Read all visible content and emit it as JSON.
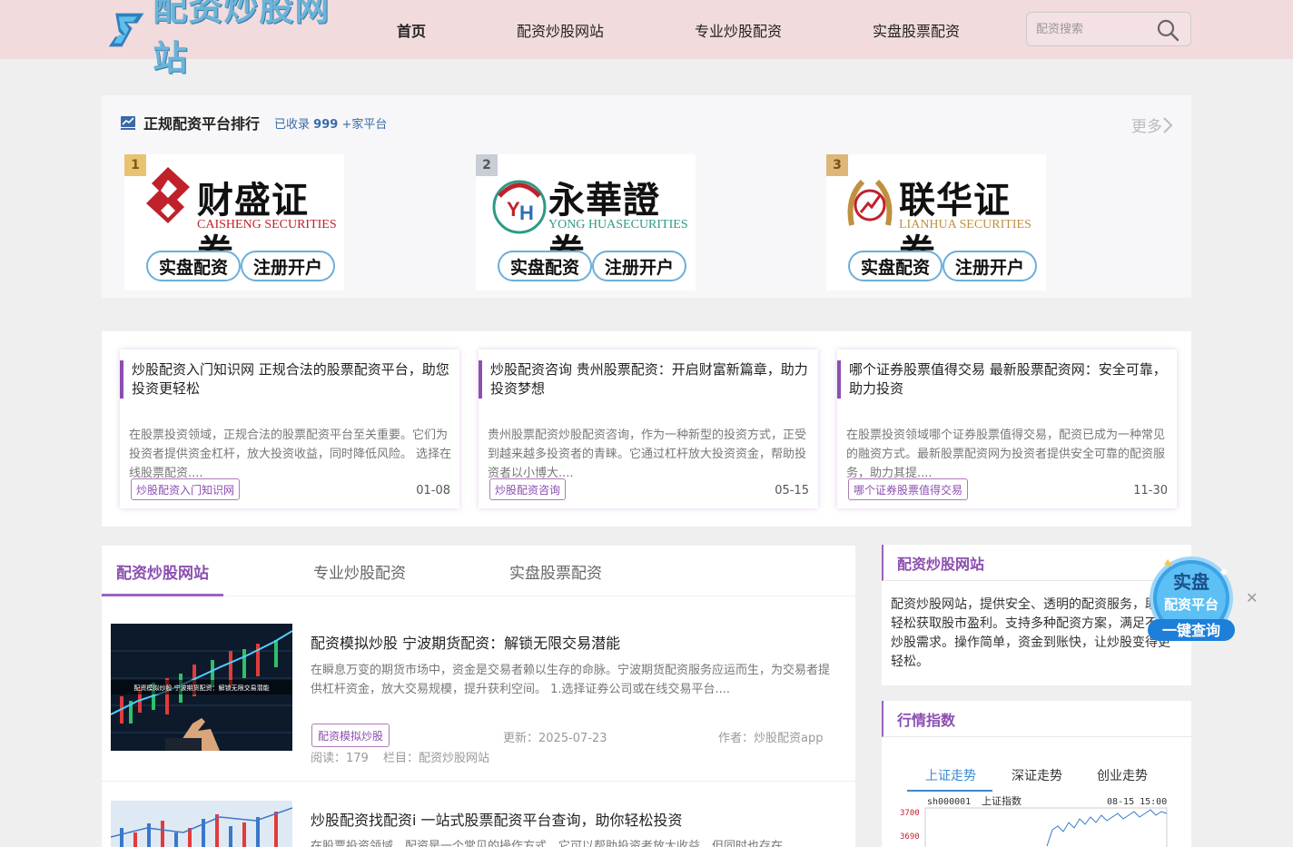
{
  "header": {
    "logo_text": "配资炒股网站",
    "nav": [
      "首页",
      "配资炒股网站",
      "专业炒股配资",
      "实盘股票配资"
    ],
    "search_placeholder": "配资搜索"
  },
  "ranking": {
    "title": "正规配资平台排行",
    "count_prefix": "已收录",
    "count_value": "999",
    "count_suffix": "+家平台",
    "more": "更多",
    "cards": [
      {
        "rank": "1",
        "name_cn": "财盛证券",
        "name_en": "CAISHENG SECURITIES",
        "btn1": "实盘配资",
        "btn2": "注册开户",
        "en_color": "#c0212b"
      },
      {
        "rank": "2",
        "name_cn": "永華證券",
        "name_en": "YONG HUASECURITIES",
        "btn1": "实盘配资",
        "btn2": "注册开户",
        "en_color": "#2c9a86"
      },
      {
        "rank": "3",
        "name_cn": "联华证券",
        "name_en": "LIANHUA SECURITIES",
        "btn1": "实盘配资",
        "btn2": "注册开户",
        "en_color": "#c09040"
      }
    ]
  },
  "articles": [
    {
      "title": "炒股配资入门知识网 正规合法的股票配资平台，助您投资更轻松",
      "desc": "在股票投资领域，正规合法的股票配资平台至关重要。它们为投资者提供资金杠杆，放大投资收益，同时降低风险。 选择在线股票配资....",
      "tag": "炒股配资入门知识网",
      "date": "01-08"
    },
    {
      "title": "炒股配资咨询 贵州股票配资：开启财富新篇章，助力投资梦想",
      "desc": "贵州股票配资炒股配资咨询，作为一种新型的投资方式，正受到越来越多投资者的青睐。它通过杠杆放大投资资金，帮助投资者以小博大....",
      "tag": "炒股配资咨询",
      "date": "05-15"
    },
    {
      "title": "哪个证券股票值得交易 最新股票配资网：安全可靠，助力投资",
      "desc": "在股票投资领域哪个证券股票值得交易，配资已成为一种常见的融资方式。最新股票配资网为投资者提供安全可靠的配资服务，助力其提....",
      "tag": "哪个证券股票值得交易",
      "date": "11-30"
    }
  ],
  "main": {
    "tabs": [
      "配资炒股网站",
      "专业炒股配资",
      "实盘股票配资"
    ],
    "posts": [
      {
        "title": "配资模拟炒股 宁波期货配资：解锁无限交易潜能",
        "desc": "在瞬息万变的期货市场中，资金是交易者赖以生存的命脉。宁波期货配资服务应运而生，为交易者提供杠杆资金，放大交易规模，提升获利空间。 1.选择证券公司或在线交易平台....",
        "tag": "配资模拟炒股",
        "updated": "更新：2025-07-23",
        "author": "作者：炒股配资app",
        "reads": "阅读：179",
        "column": "栏目：配资炒股网站",
        "thumb_caption": "配资模拟炒股 宁波期货配资：解锁无限交易潜能"
      },
      {
        "title": "炒股配资找配资i 一站式股票配资平台查询，助你轻松投资",
        "desc": "在股票投资领域，配资是一个常见的操作方式，它可以帮助投资者放大收益，但同时也存在",
        "tag": "",
        "updated": "",
        "author": "",
        "reads": "",
        "column": "",
        "thumb_caption": ""
      }
    ]
  },
  "sidebar": {
    "about_title": "配资炒股网站",
    "about_text": "配资炒股网站，提供安全、透明的配资服务，助您轻松获取股市盈利。支持多种配资方案，满足不同炒股需求。操作简单，资金到账快，让炒股变得更轻松。",
    "index_title": "行情指数",
    "index_tabs": [
      "上证走势",
      "深证走势",
      "创业走势"
    ],
    "chart": {
      "code": "sh000001",
      "name": "上证指数",
      "time": "08-15 15:00",
      "y_top": "3700",
      "y_second": "3690"
    }
  },
  "float_widget": {
    "line1": "实盘",
    "line2": "配资平台",
    "line3": "一键查询",
    "close": "✕"
  },
  "colors": {
    "accent_purple": "#8c4fb0",
    "header_bg": "#f1dbdd",
    "link_blue": "#3a8ad0"
  }
}
